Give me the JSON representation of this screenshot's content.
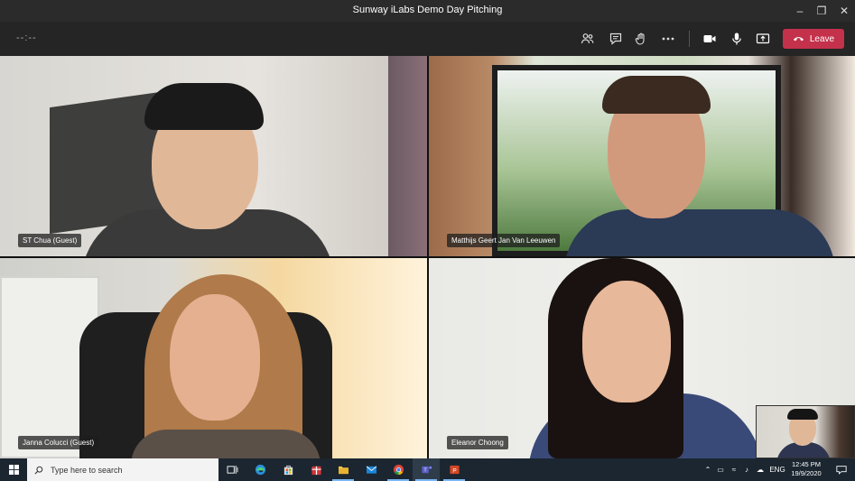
{
  "window": {
    "title": "Sunway iLabs Demo Day Pitching"
  },
  "toolbar": {
    "timer": "--:--",
    "leave_label": "Leave",
    "icons": [
      "participants-icon",
      "chat-icon",
      "raise-hand-icon",
      "more-options-icon",
      "camera-icon",
      "microphone-icon",
      "share-screen-icon"
    ]
  },
  "participants": [
    {
      "name": "ST Chua (Guest)"
    },
    {
      "name": "Matthijs Geert Jan Van Leeuwen"
    },
    {
      "name": "Janna Colucci (Guest)"
    },
    {
      "name": "Eleanor Choong"
    }
  ],
  "taskbar": {
    "search_placeholder": "Type here to search",
    "tray_lang": "ENG",
    "time": "12:45 PM",
    "date": "19/9/2020"
  },
  "colors": {
    "leave": "#c4314b",
    "titlebar": "#2b2b2b",
    "toolbar": "#252525",
    "taskbar": "#1b2630"
  }
}
